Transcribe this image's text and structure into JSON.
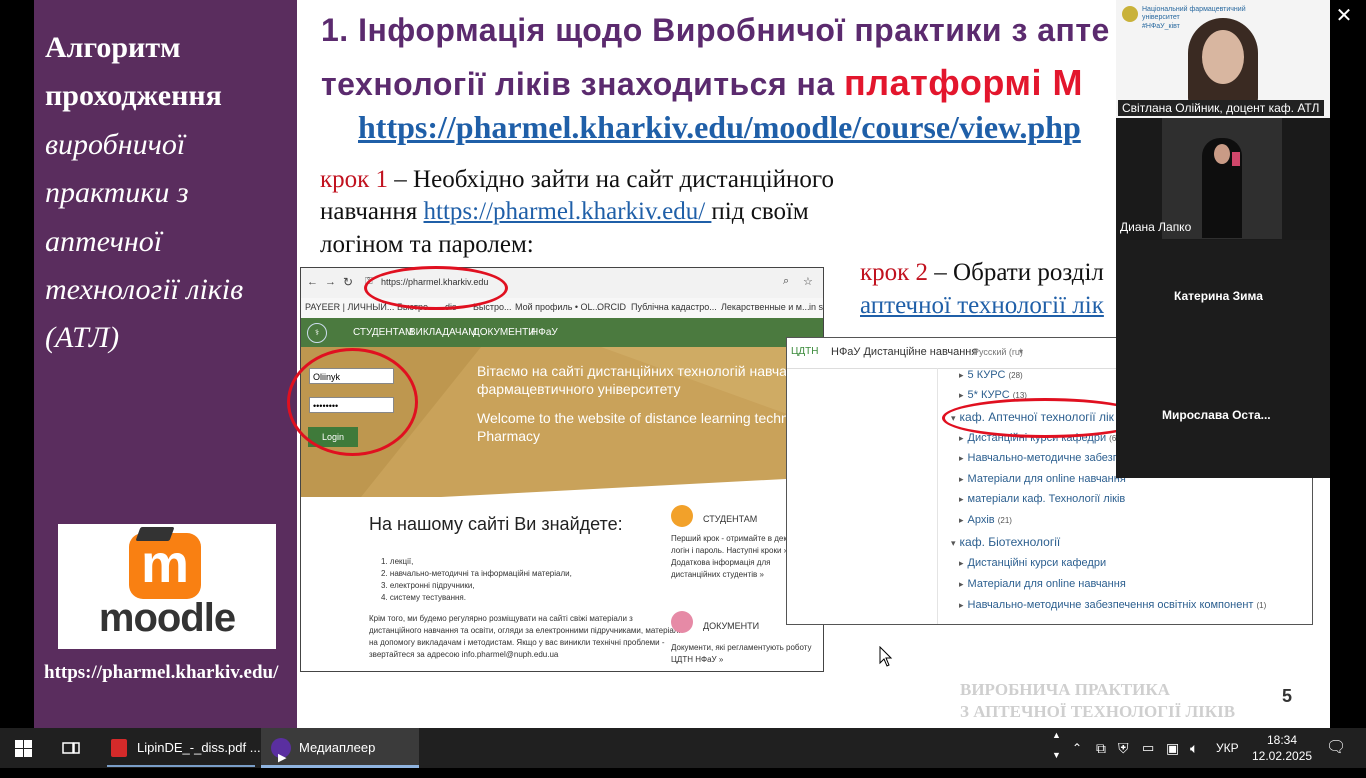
{
  "slide": {
    "left_panel": {
      "title_line1": "Алгоритм",
      "title_line2": "проходження",
      "italic_lines": [
        "виробничої",
        "практики з",
        "аптечної",
        "технології ліків",
        "(АТЛ)"
      ],
      "logo_word": "moodle",
      "url": "https://pharmel.kharkiv.edu/"
    },
    "heading_line1": "1. Інформація щодо Виробничої практики з апте",
    "heading_line2_a": "технології ліків знаходиться на ",
    "heading_line2_b": "платформі M",
    "main_link": "https://pharmel.kharkiv.edu/moodle/course/view.php",
    "step1": {
      "label": "крок 1",
      "text_a": " – Необхідно зайти на сайт дистанційного",
      "text_b": "навчання ",
      "link": "https://pharmel.kharkiv.edu/ ",
      "text_c": "під своїм",
      "text_d": "логіном та паролем:"
    },
    "step2": {
      "label": "крок 2",
      "text_a": " – Обрати розділ",
      "link": "аптечної технології лік"
    },
    "page_number": "5",
    "watermark_line1": "ВИРОБНИЧА ПРАКТИКА",
    "watermark_line2": "З АПТЕЧНОЇ ТЕХНОЛОГІЇ ЛІКІВ",
    "shot1": {
      "address": "https://pharmel.kharkiv.edu",
      "bookmarks": [
        "PAYEER | ЛИЧНЫЙ...",
        "Быстро",
        "dis",
        "Быстро...",
        "Мой профиль • OL...",
        "ORCID",
        "Публічна кадастро...",
        "Лекарственные и м...",
        "in s"
      ],
      "nav": [
        "СТУДЕНТАМ",
        "ВИКЛАДАЧАМ",
        "ДОКУМЕНТИ",
        "НФаУ"
      ],
      "username": "Oliinyk",
      "password": "••••••••",
      "login_button": "Login",
      "hero_ua_1": "Вітаємо на сайті дистанційних технологій навчання Нац",
      "hero_ua_2": "фармацевтичного університету",
      "hero_en_1": "Welcome to the website of distance learning technologies o",
      "hero_en_2": "Pharmacy",
      "find_heading": "На нашому сайті Ви знайдете:",
      "find_list": [
        "1. лекції,",
        "2. навчально-методичні та інформаційні матеріали,",
        "3. електронні підручники,",
        "4. систему тестування."
      ],
      "paragraph": [
        "Крім того, ми будемо регулярно розміщувати на сайті свіжі матеріали з",
        "дистанційного навчання та освіти, огляди за електронними підручниками, матеріали",
        "на допомогу викладачам і методистам. Якщо у вас виникли технічні проблеми -",
        "звертайтеся за адресою info.pharmel@nuph.edu.ua"
      ],
      "students_title": "СТУДЕНТАМ",
      "students_text": [
        "Перший крок - отримайте в декан",
        "логін і пароль. Наступні кроки »",
        "Додаткова інформація для",
        "дистанційних студентів »"
      ],
      "docs_title": "ДОКУМЕНТИ",
      "docs_text": [
        "Документи, які регламентують роботу",
        "ЦДТН НФаУ »"
      ]
    },
    "shot2": {
      "brand": "ЦДТН",
      "site_title": "НФаУ Дистанційне навчання",
      "language": "Русский (ru)",
      "items": [
        {
          "label": "5 КУРС",
          "count": "(28)"
        },
        {
          "label": "5* КУРС",
          "count": "(13)"
        },
        {
          "label": "каф. Аптечної технології лік",
          "count": ""
        },
        {
          "label": "Дистанційні курси кафедри",
          "count": "(6)"
        },
        {
          "label": "Навчально-методичне забезп",
          "count": ""
        },
        {
          "label": "Матеріали для online навчання",
          "count": ""
        },
        {
          "label": "матеріали каф. Технології ліків",
          "count": ""
        },
        {
          "label": "Архів",
          "count": "(21)"
        },
        {
          "label": "каф. Біотехнології",
          "count": ""
        },
        {
          "label": "Дистанційні курси кафедри",
          "count": ""
        },
        {
          "label": "Матеріали для online навчання",
          "count": ""
        },
        {
          "label": "Навчально-методичне забезпечення освітніх компонент",
          "count": "(1)"
        }
      ]
    }
  },
  "video_panel": {
    "logo_text_1": "Національний фармацевтичний",
    "logo_text_2": "університет",
    "logo_text_3": "#НФаУ_ківт",
    "speaker": "Світлана Олійник, доцент каф. АТЛ",
    "participants": [
      "Диана Лапко",
      "Катерина Зима",
      "Мирослава  Оста..."
    ]
  },
  "taskbar": {
    "apps": [
      "LipinDE_-_diss.pdf ...",
      "Медиаплеер"
    ],
    "language": "УКР",
    "time": "18:34",
    "date": "12.02.2025"
  },
  "colors": {
    "left_panel": "#5a2d5e",
    "heading": "#5b2a6e",
    "accent_red": "#e3162d",
    "link_blue": "#1f5fa8",
    "moodle_orange": "#f98012"
  }
}
